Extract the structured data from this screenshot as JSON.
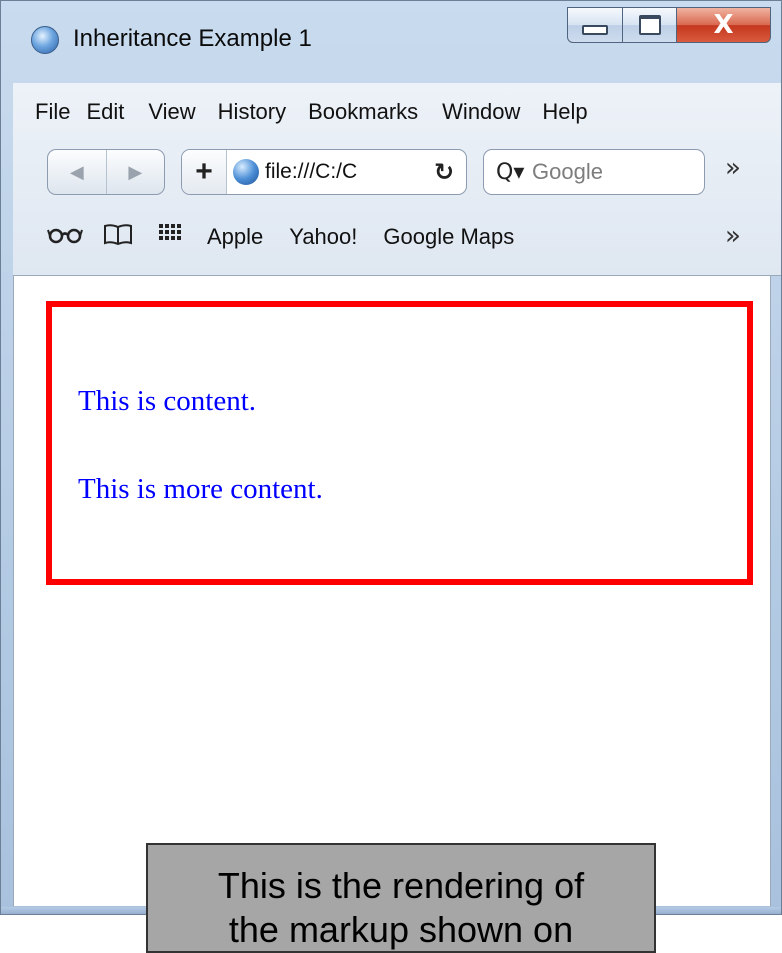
{
  "window": {
    "title": "Inheritance Example 1",
    "minimize_icon": "minimize-icon",
    "maximize_icon": "maximize-icon",
    "close_glyph": "X"
  },
  "menu": {
    "items": [
      "File",
      "Edit",
      "View",
      "History",
      "Bookmarks",
      "Window",
      "Help"
    ]
  },
  "toolbar": {
    "back_glyph": "◀",
    "forward_glyph": "▶",
    "add_glyph": "+",
    "url": "file:///C:/C",
    "reload_glyph": "↻",
    "search_glyph": "Q▾",
    "search_placeholder": "Google",
    "overflow_glyph": "»"
  },
  "bookmarks_bar": {
    "reader_icon": "glasses-icon",
    "book_icon": "book-icon",
    "grid_icon": "grid-icon",
    "items": [
      "Apple",
      "Yahoo!",
      "Google Maps"
    ],
    "overflow_glyph": "»"
  },
  "page": {
    "border_color": "#ff0000",
    "text_color": "#0000ff",
    "paragraphs": [
      "This is content.",
      "This is more content."
    ]
  },
  "caption": {
    "lines": [
      "This is the rendering of",
      "the markup shown on"
    ]
  }
}
